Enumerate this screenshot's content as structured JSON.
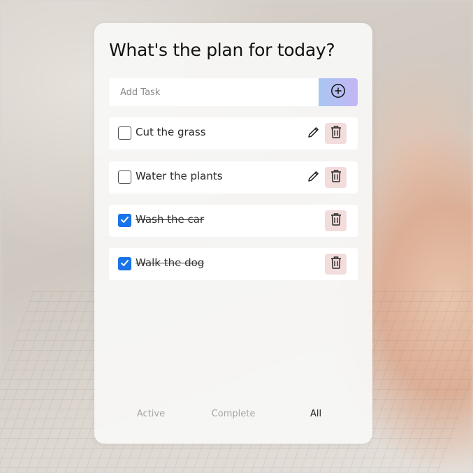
{
  "app": {
    "title": "What's the plan for today?"
  },
  "add_task": {
    "placeholder": "Add Task",
    "value": "",
    "button_icon": "plus-circle-icon",
    "button_gradient": [
      "#a9c6f2",
      "#c3b6f4"
    ]
  },
  "tasks": [
    {
      "label": "Cut the grass",
      "completed": false,
      "editable": true
    },
    {
      "label": "Water the plants",
      "completed": false,
      "editable": true
    },
    {
      "label": "Wash the car",
      "completed": true,
      "editable": false
    },
    {
      "label": "Walk the dog",
      "completed": true,
      "editable": false
    }
  ],
  "filters": {
    "items": [
      "Active",
      "Complete",
      "All"
    ],
    "selected": "All"
  },
  "colors": {
    "checkbox_checked": "#1a73e8",
    "delete_button_bg": "#f3dcdc",
    "filter_inactive": "#a6a6a6",
    "filter_active": "#222222"
  }
}
